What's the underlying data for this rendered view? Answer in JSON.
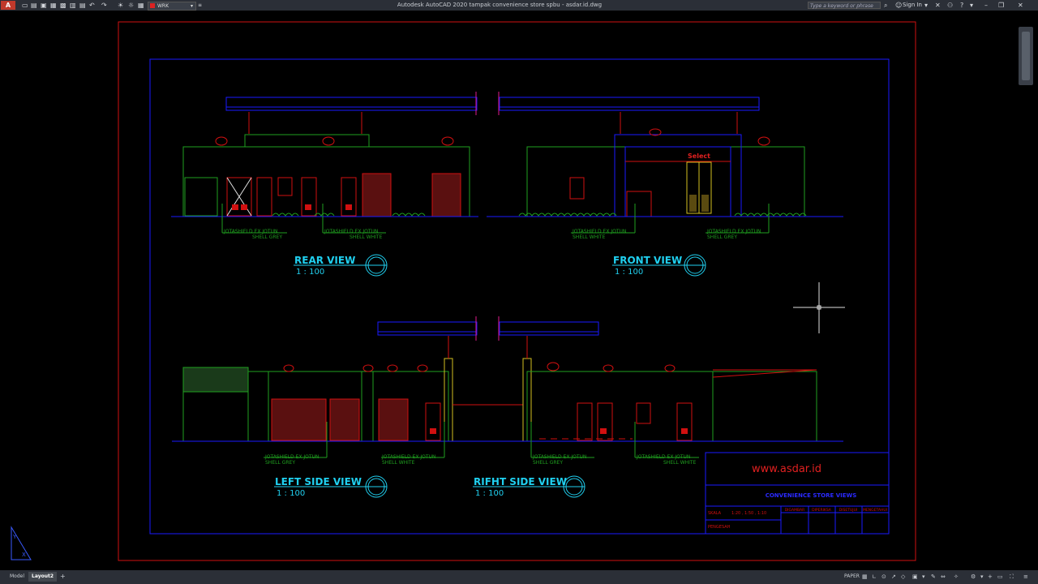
{
  "app": {
    "logo": "A",
    "title": "Autodesk AutoCAD 2020   tampak convenience store spbu - asdar.id.dwg",
    "workspace": "WRK",
    "search_placeholder": "Type a keyword or phrase",
    "sign_in": "Sign In"
  },
  "drawing": {
    "views": [
      {
        "title": "REAR VIEW",
        "scale": "1 : 100"
      },
      {
        "title": "FRONT VIEW",
        "scale": "1 : 100"
      },
      {
        "title": "LEFT SIDE VIEW",
        "scale": "1 : 100"
      },
      {
        "title": "RIFHT SIDE VIEW",
        "scale": "1 : 100"
      }
    ],
    "callouts": [
      {
        "line1": "JOTASHIELD  EX  JOTUN",
        "line2": "SHELL  GREY"
      },
      {
        "line1": "JOTASHIELD  EX  JOTUN",
        "line2": "SHELL  WHITE"
      },
      {
        "line1": "JOTASHIELD  EX  JOTUN",
        "line2": "SHELL  WHITE"
      },
      {
        "line1": "JOTASHIELD  EX  JOTUN",
        "line2": "SHELL  GREY"
      },
      {
        "line1": "JOTASHIELD  EX  JOTUN",
        "line2": "SHELL  GREY"
      },
      {
        "line1": "JOTASHIELD  EX  JOTUN",
        "line2": "SHELL  WHITE"
      },
      {
        "line1": "JOTASHIELD  EX  JOTUN",
        "line2": "SHELL  GREY"
      },
      {
        "line1": "JOTASHIELD  EX  JOTUN",
        "line2": "SHELL  WHITE"
      }
    ],
    "sign_text": "Select",
    "titleblock": {
      "website": "www.asdar.id",
      "sheet_title": "CONVENIENCE STORE VIEWS",
      "skala_label": "SKALA",
      "skala_value": "1:20  ,  1:50  ,  1:10",
      "pengesah_label": "PENGESAH",
      "cols": [
        "DIGAMBAR",
        "DIPERIKSA",
        "DISETUJUI",
        "MENGETAHUI"
      ]
    },
    "ucs": {
      "y": "Y",
      "x": "X"
    }
  },
  "status": {
    "tabs": [
      "Model",
      "Layout2"
    ],
    "plus": "+",
    "paper": "PAPER"
  }
}
